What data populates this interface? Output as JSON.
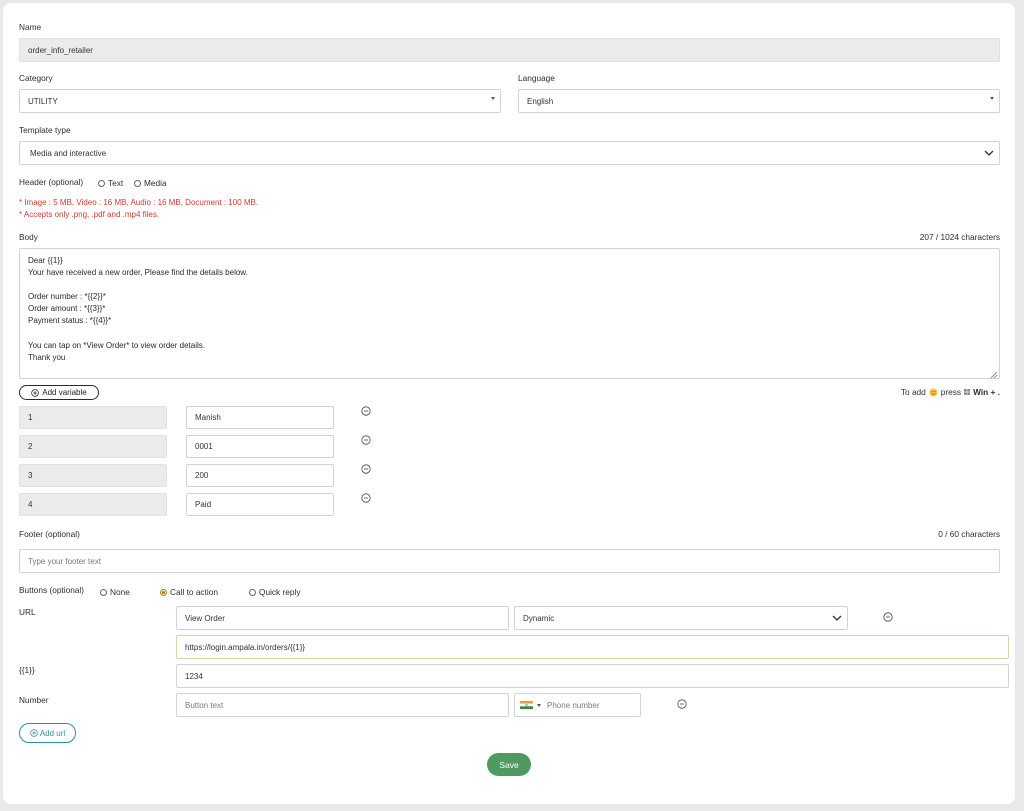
{
  "name": {
    "label": "Name",
    "value": "order_info_retailer"
  },
  "category": {
    "label": "Category",
    "value": "UTILITY"
  },
  "language": {
    "label": "Language",
    "value": "English"
  },
  "template_type": {
    "label": "Template type",
    "value": "Media and interactive"
  },
  "header": {
    "label": "Header (optional)",
    "options": [
      "Text",
      "Media"
    ],
    "selected": null,
    "warning_1": "* Image : 5 MB, Video : 16 MB, Audio : 16 MB, Document : 100 MB.",
    "warning_2": "* Accepts only .png, .pdf and .mp4 files."
  },
  "body": {
    "label": "Body",
    "counter": "207 / 1024 characters",
    "text": "Dear {{1}}\nYour have received a new order, Please find the details below.\n\nOrder number : *{{2}}*\nOrder amount : *{{3}}*\nPayment status : *{{4}}*\n\nYou can tap on *View Order* to view order details.\nThank you",
    "add_variable_label": "Add variable",
    "emoji_hint_prefix": "To add",
    "emoji_hint_mid": "press",
    "emoji_hint_keys": "Win + ."
  },
  "variables": [
    {
      "key": "1",
      "value": "Manish"
    },
    {
      "key": "2",
      "value": "0001"
    },
    {
      "key": "3",
      "value": "200"
    },
    {
      "key": "4",
      "value": "Paid"
    }
  ],
  "footer": {
    "label": "Footer (optional)",
    "counter": "0 / 60 characters",
    "placeholder": "Type your footer text"
  },
  "buttons": {
    "label": "Buttons (optional)",
    "options": [
      "None",
      "Call to action",
      "Quick reply"
    ],
    "selected": "Call to action",
    "url_label": "URL",
    "url_button_text": "View Order",
    "url_type": "Dynamic",
    "url_value": "https://login.ampala.in/orders/{{1}}",
    "url_var_label": "{{1}}",
    "url_var_value": "1234",
    "number_label": "Number",
    "number_button_placeholder": "Button text",
    "phone_placeholder": "Phone number",
    "add_url_label": "Add url"
  },
  "save_label": "Save",
  "colors": {
    "save": "#4e9a60",
    "warning": "#d33a32",
    "radio_selected": "#b07a10",
    "add_url": "#2a8fa0"
  },
  "icons": [
    "chevron-down-icon",
    "caret-down-icon",
    "plus-circle-icon",
    "minus-circle-icon",
    "india-flag-icon",
    "emoji-icon",
    "windows-icon",
    "resize-handle-icon"
  ]
}
